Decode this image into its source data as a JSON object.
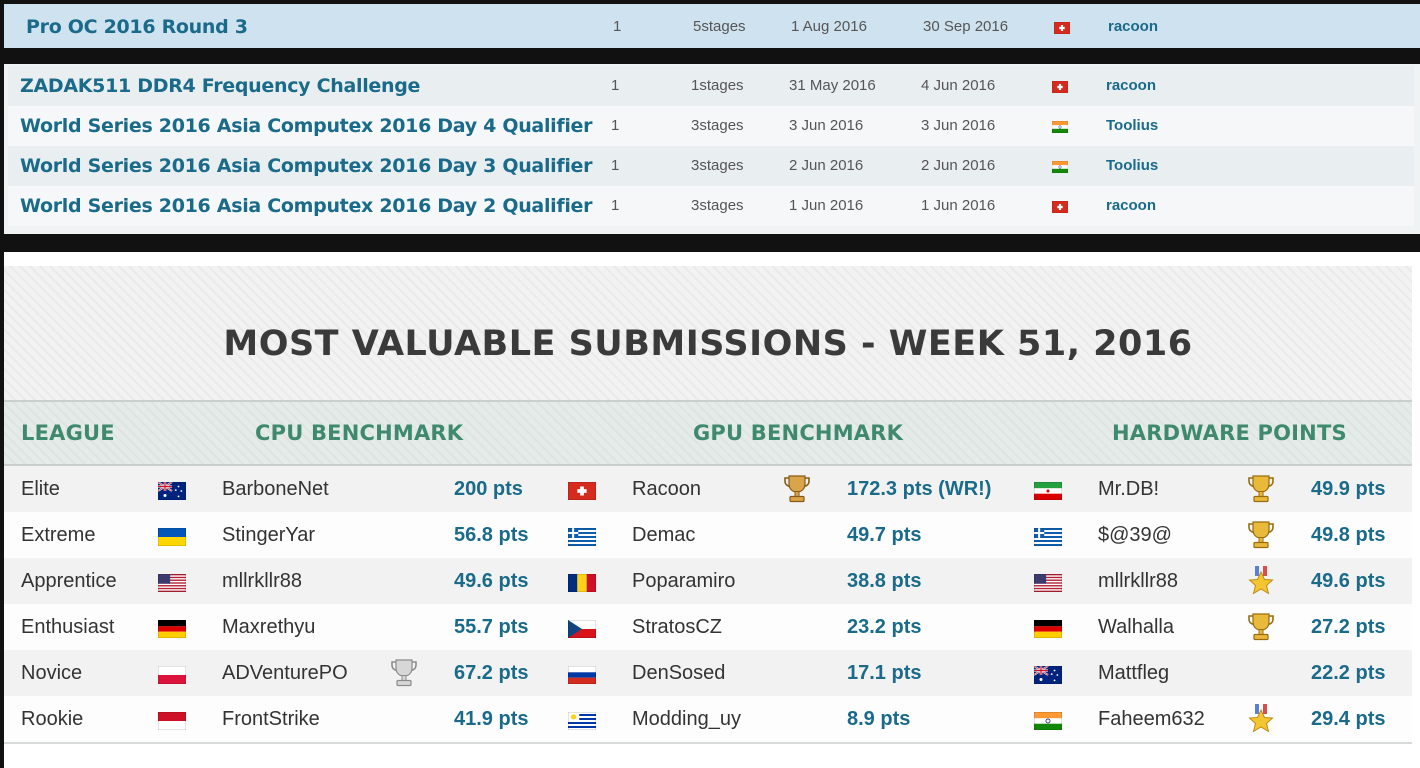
{
  "competitions": [
    {
      "name": "Pro OC 2016 Round 3",
      "count": "1",
      "stages": "5stages",
      "start": "1 Aug 2016",
      "end": "30 Sep 2016",
      "flag": "ch",
      "user": "racoon"
    },
    {
      "name": "ZADAK511 DDR4 Frequency Challenge",
      "count": "1",
      "stages": "1stages",
      "start": "31 May 2016",
      "end": "4 Jun 2016",
      "flag": "ch",
      "user": "racoon"
    },
    {
      "name": "World Series 2016 Asia Computex 2016 Day 4 Qualifier",
      "count": "1",
      "stages": "3stages",
      "start": "3 Jun 2016",
      "end": "3 Jun 2016",
      "flag": "in",
      "user": "Toolius"
    },
    {
      "name": "World Series 2016 Asia Computex 2016 Day 3 Qualifier",
      "count": "1",
      "stages": "3stages",
      "start": "2 Jun 2016",
      "end": "2 Jun 2016",
      "flag": "in",
      "user": "Toolius"
    },
    {
      "name": "World Series 2016 Asia Computex 2016 Day 2 Qualifier",
      "count": "1",
      "stages": "3stages",
      "start": "1 Jun 2016",
      "end": "1 Jun 2016",
      "flag": "ch",
      "user": "racoon"
    }
  ],
  "mvs": {
    "title": "MOST VALUABLE SUBMISSIONS - WEEK 51, 2016",
    "headers": {
      "league": "LEAGUE",
      "cpu": "CPU BENCHMARK",
      "gpu": "GPU BENCHMARK",
      "hw": "HARDWARE POINTS"
    },
    "rows": [
      {
        "league": "Elite",
        "cpu": {
          "flag": "au",
          "user": "BarboneNet",
          "trophy": "",
          "pts": "200 pts"
        },
        "gpu": {
          "flag": "ch",
          "user": "Racoon",
          "trophy": "bronze-cup",
          "pts": "172.3 pts (WR!)"
        },
        "hw": {
          "flag": "ir",
          "user": "Mr.DB!",
          "trophy": "gold-cup",
          "pts": "49.9 pts"
        }
      },
      {
        "league": "Extreme",
        "cpu": {
          "flag": "ua",
          "user": "StingerYar",
          "trophy": "",
          "pts": "56.8 pts"
        },
        "gpu": {
          "flag": "gr",
          "user": "Demac",
          "trophy": "",
          "pts": "49.7 pts"
        },
        "hw": {
          "flag": "gr",
          "user": "$@39@",
          "trophy": "gold-cup",
          "pts": "49.8 pts"
        }
      },
      {
        "league": "Apprentice",
        "cpu": {
          "flag": "us",
          "user": "mllrkllr88",
          "trophy": "",
          "pts": "49.6 pts"
        },
        "gpu": {
          "flag": "ro",
          "user": "Poparamiro",
          "trophy": "",
          "pts": "38.8 pts"
        },
        "hw": {
          "flag": "us",
          "user": "mllrkllr88",
          "trophy": "star-medal",
          "pts": "49.6 pts"
        }
      },
      {
        "league": "Enthusiast",
        "cpu": {
          "flag": "de",
          "user": "Maxrethyu",
          "trophy": "",
          "pts": "55.7 pts"
        },
        "gpu": {
          "flag": "cz",
          "user": "StratosCZ",
          "trophy": "",
          "pts": "23.2 pts"
        },
        "hw": {
          "flag": "de",
          "user": "Walhalla",
          "trophy": "gold-cup",
          "pts": "27.2 pts"
        }
      },
      {
        "league": "Novice",
        "cpu": {
          "flag": "pl",
          "user": "ADVenturePO",
          "trophy": "silver-cup",
          "pts": "67.2 pts"
        },
        "gpu": {
          "flag": "ru",
          "user": "DenSosed",
          "trophy": "",
          "pts": "17.1 pts"
        },
        "hw": {
          "flag": "au",
          "user": "Mattfleg",
          "trophy": "",
          "pts": "22.2 pts"
        }
      },
      {
        "league": "Rookie",
        "cpu": {
          "flag": "id",
          "user": "FrontStrike",
          "trophy": "",
          "pts": "41.9 pts"
        },
        "gpu": {
          "flag": "uy",
          "user": "Modding_uy",
          "trophy": "",
          "pts": "8.9 pts"
        },
        "hw": {
          "flag": "in",
          "user": "Faheem632",
          "trophy": "star-medal",
          "pts": "29.4 pts"
        }
      }
    ]
  }
}
